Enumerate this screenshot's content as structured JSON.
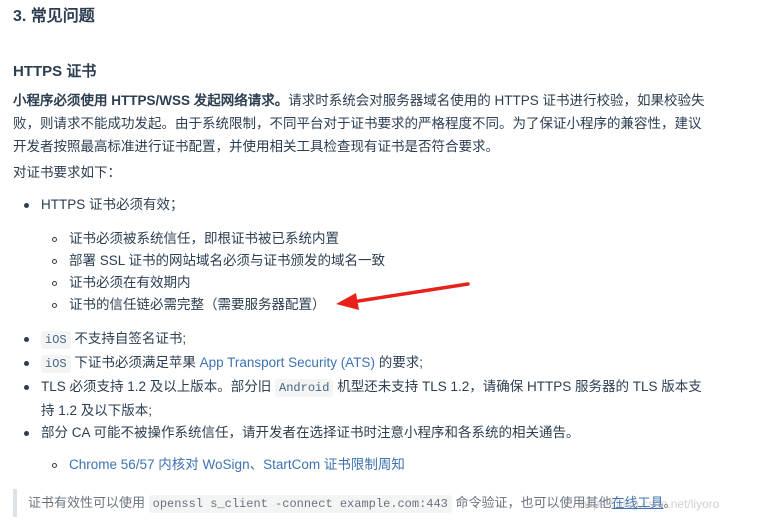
{
  "section_title": "3. 常见问题",
  "subsection_title": "HTTPS 证书",
  "intro": {
    "bold": "小程序必须使用 HTTPS/WSS 发起网络请求。",
    "line1_rest": "请求时系统会对服务器域名使用的 HTTPS 证书进行校验，如果校验失",
    "line2": "败，则请求不能成功发起。由于系统限制，不同平台对于证书要求的严格程度不同。为了保证小程序的兼容性，建议",
    "line3": "开发者按照最高标准进行证书配置，并使用相关工具检查现有证书是否符合要求。"
  },
  "requirements_intro": "对证书要求如下：",
  "list": {
    "item1": "HTTPS 证书必须有效；",
    "sub1": [
      "证书必须被系统信任，即根证书被已系统内置",
      "部署 SSL 证书的网站域名必须与证书颁发的域名一致",
      "证书必须在有效期内",
      "证书的信任链必需完整（需要服务器配置）"
    ],
    "item2_code": "iOS",
    "item2_text": " 不支持自签名证书;",
    "item3_code": "iOS",
    "item3_text_a": " 下证书必须满足苹果 ",
    "item3_link": "App Transport Security (ATS)",
    "item3_text_b": " 的要求;",
    "item4_a": "TLS 必须支持 1.2 及以上版本。部分旧 ",
    "item4_code": "Android",
    "item4_b": " 机型还未支持 TLS 1.2，请确保 HTTPS 服务器的 TLS 版本支",
    "item4_line2": "持 1.2 及以下版本;",
    "item5": "部分 CA 可能不被操作系统信任，请开发者在选择证书时注意小程序和各系统的相关通告。",
    "sub5_link": "Chrome 56/57 内核对 WoSign、StartCom 证书限制周知"
  },
  "tip": {
    "text_a": "证书有效性可以使用 ",
    "code": "openssl s_client -connect example.com:443",
    "text_b": " 命令验证，也可以使用其他",
    "link": "在线工具",
    "text_c": "。"
  },
  "watermark": "https://blog.csdn.net/liyoro",
  "colors": {
    "text": "#2c3e50",
    "link": "#3e72b0",
    "arrow": "#e8211b",
    "code_bg": "#f3f4f4"
  }
}
